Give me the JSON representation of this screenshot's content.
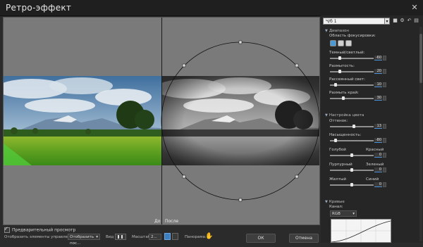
{
  "window": {
    "title": "Ретро-эффект",
    "close_glyph": "✕"
  },
  "preview": {
    "before_label": "До",
    "after_label": "После"
  },
  "bottom": {
    "preview_checkbox_label": "Предварительный просмотр",
    "preview_checked": true,
    "show_controls_label": "Отобразить элементы управления:",
    "show_controls_value": "Отобразить пос...",
    "view_label": "Вид",
    "zoom_label": "Масштаб:",
    "zoom_value": "2...",
    "panorama_label": "Панорама:",
    "ok_label": "ОК",
    "cancel_label": "Отмена"
  },
  "panel": {
    "preset_value": "Ч/б 1",
    "section_range": "Диапазон",
    "focus_area_label": "Область фокусировки:",
    "sliders_range": [
      {
        "label": "Темный/светлый:",
        "value": "-60",
        "pos": 0.2
      },
      {
        "label": "Размытость:",
        "value": "20",
        "pos": 0.2
      },
      {
        "label": "Рассеянный свет:",
        "value": "10",
        "pos": 0.1
      },
      {
        "label": "Размыть край:",
        "value": "30",
        "pos": 0.3
      }
    ],
    "section_color": "Настройка цвета",
    "sliders_color": [
      {
        "label": "Оттенок:",
        "value": "13",
        "pos": 0.55
      },
      {
        "label": "Насыщенность:",
        "value": "-80",
        "pos": 0.1
      }
    ],
    "pair_sliders": [
      {
        "left": "Голубой",
        "right": "Красный",
        "value": "0",
        "pos": 0.5
      },
      {
        "left": "Пурпурный",
        "right": "Зеленый",
        "value": "0",
        "pos": 0.5
      },
      {
        "left": "Желтый",
        "right": "Синий",
        "value": "0",
        "pos": 0.5
      }
    ],
    "section_curves": "Кривые",
    "channel_label": "Канал:",
    "channel_value": "RGB"
  }
}
